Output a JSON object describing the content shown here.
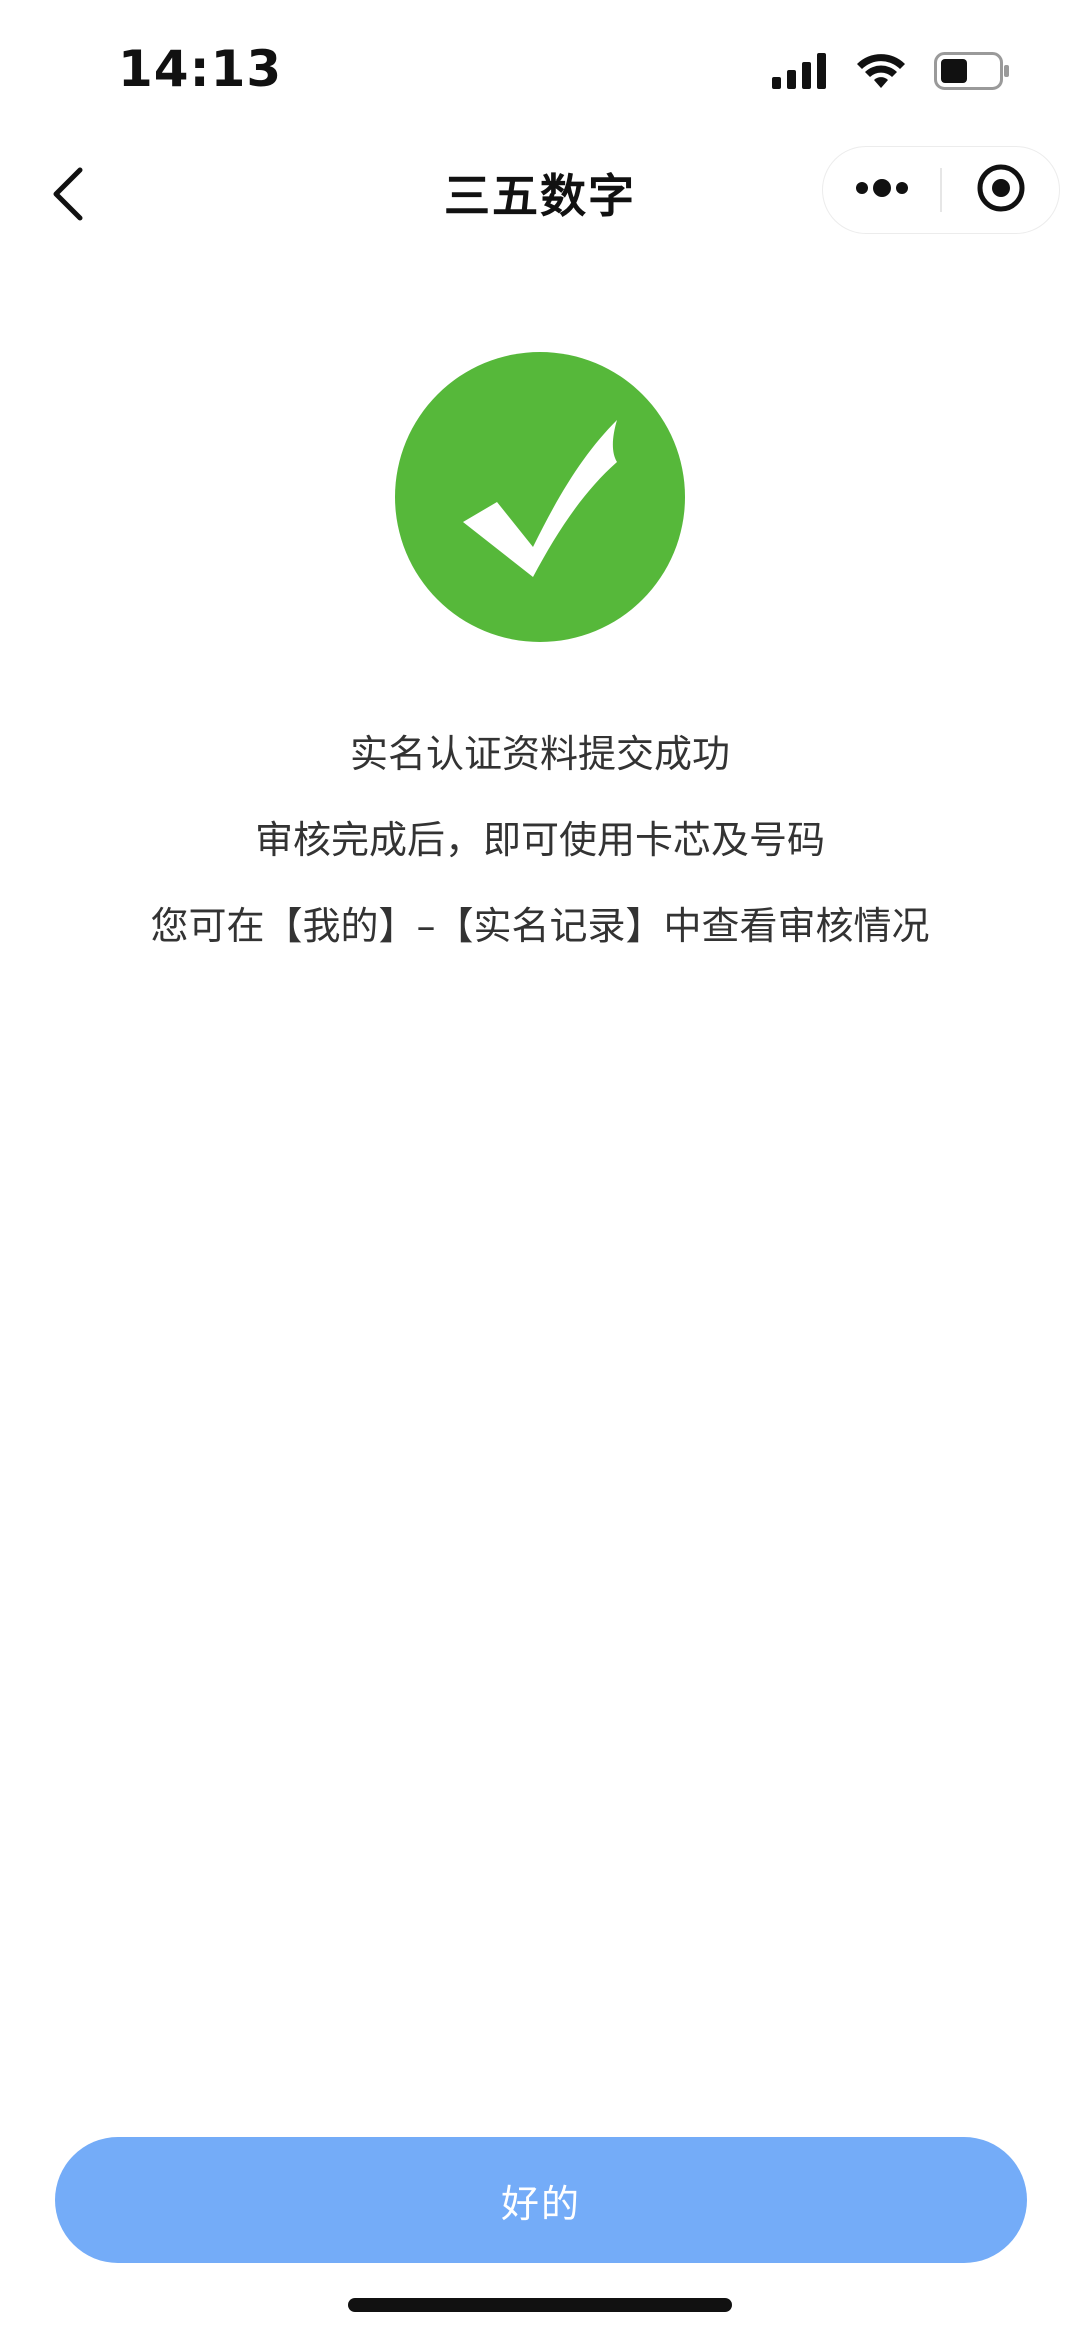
{
  "status_bar": {
    "time": "14:13",
    "icons": [
      "signal-icon",
      "wifi-icon",
      "battery-icon"
    ]
  },
  "nav": {
    "title": "三五数字",
    "icons": [
      "back-icon",
      "more-icon",
      "close-miniprogram-icon"
    ]
  },
  "result": {
    "icon": "success-check-icon",
    "icon_color": "#56b83a",
    "lines": [
      "实名认证资料提交成功",
      "审核完成后，即可使用卡芯及号码",
      "您可在【我的】–【实名记录】中查看审核情况"
    ]
  },
  "footer": {
    "ok_label": "好的",
    "button_color": "#74acf8"
  }
}
